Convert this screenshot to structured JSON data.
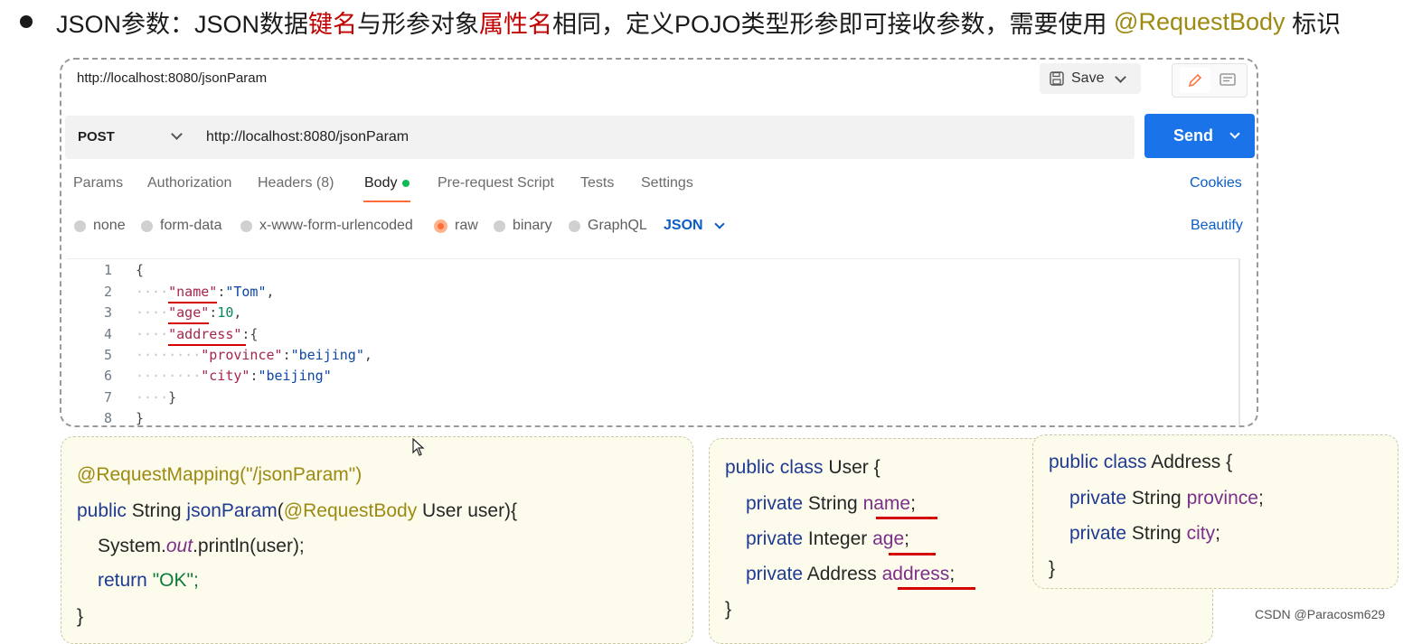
{
  "headline": {
    "prefix": "JSON参数：JSON数据",
    "key_name": "键名",
    "mid1": "与形参对象",
    "attr_name": "属性名",
    "mid2": "相同，定义POJO类型形参即可接收参数，需要使用 ",
    "annotation": "@RequestBody",
    "suffix": " 标识"
  },
  "postman": {
    "title_url": "http://localhost:8080/jsonParam",
    "save_label": "Save",
    "method": "POST",
    "request_url": "http://localhost:8080/jsonParam",
    "send_label": "Send",
    "tabs": [
      {
        "label": "Params"
      },
      {
        "label": "Authorization"
      },
      {
        "label": "Headers (8)"
      },
      {
        "label": "Body"
      },
      {
        "label": "Pre-request Script"
      },
      {
        "label": "Tests"
      },
      {
        "label": "Settings"
      }
    ],
    "active_tab": "Body",
    "cookies_label": "Cookies",
    "body_options": [
      {
        "label": "none"
      },
      {
        "label": "form-data"
      },
      {
        "label": "x-www-form-urlencoded"
      },
      {
        "label": "raw"
      },
      {
        "label": "binary"
      },
      {
        "label": "GraphQL"
      }
    ],
    "selected_body_option": "raw",
    "format_label": "JSON",
    "beautify_label": "Beautify",
    "editor": {
      "line_numbers": [
        "1",
        "2",
        "3",
        "4",
        "5",
        "6",
        "7",
        "8"
      ],
      "open_brace": "{",
      "key_name": "\"name\"",
      "val_name": "\"Tom\"",
      "key_age": "\"age\"",
      "val_age": "10",
      "key_address": "\"address\"",
      "key_province": "\"province\"",
      "val_province": "\"beijing\"",
      "key_city": "\"city\"",
      "val_city": "\"beijing\"",
      "close_inner": "}",
      "close_outer": "}"
    }
  },
  "controller_code": {
    "annotation_line": "@RequestMapping(\"/jsonParam\")",
    "sig_public": "public",
    "sig_type": " String ",
    "sig_method": "jsonParam",
    "sig_open": "(",
    "sig_annotation": "@RequestBody",
    "sig_rest": " User user){",
    "print_prefix": "System.",
    "print_out": "out",
    "print_suffix": ".println(user);",
    "return_kw": "return",
    "return_val": " \"OK\";",
    "close": "}"
  },
  "user_class": {
    "header_kw": "public class",
    "header_name": " User {",
    "f1_kw": "private",
    "f1_type": " String ",
    "f1_name": "name",
    "f2_kw": "private",
    "f2_type": " Integer ",
    "f2_name": "age",
    "f3_kw": "private",
    "f3_type": " Address ",
    "f3_name": "address",
    "semicolon": ";",
    "close": "}"
  },
  "address_class": {
    "header_kw": "public class",
    "header_name": " Address {",
    "f1_kw": "private",
    "f1_type": " String ",
    "f1_name": "province",
    "f2_kw": "private",
    "f2_type": " String ",
    "f2_name": "city",
    "semicolon": ";",
    "close": "}"
  },
  "watermark": "CSDN @Paracosm629",
  "colors": {
    "send_button": "#1a73e8",
    "active_tab_underline": "#ff6c37",
    "highlight_red": "#c00000",
    "annotation_olive": "#9c8a12",
    "link_blue": "#0b5dc5"
  }
}
